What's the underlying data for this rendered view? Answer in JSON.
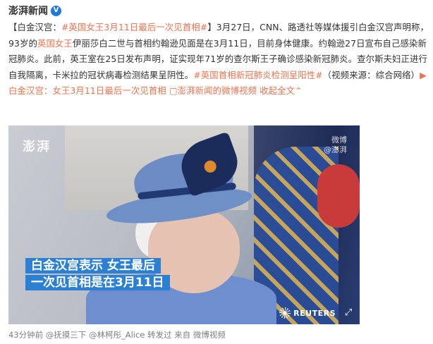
{
  "header": {
    "author": "澎湃新闻",
    "verified_mark": "V"
  },
  "post": {
    "prefix": "【白金汉宫：",
    "topic1": "#英国女王3月11日最后一次见首相#",
    "text1": "】3月27日，CNN、路透社等媒体援引白金汉宫声明称，93岁的",
    "topic_inline1": "英国女王",
    "text2": "伊丽莎白二世与首相约翰逊见面是在3月11日，目前身体健康。约翰逊27日宣布自己感染新冠肺炎。此前，英王室在25日发布声明，证实现年71岁的查尔斯王子确诊感染新冠肺炎。查尔斯夫妇正进行自我隔离，卡米拉的冠状病毒检测结果呈阴性。",
    "topic2": "#英国首相新冠肺炎检测呈阳性#",
    "text3": "（视频来源：综合网络）",
    "link_label": "白金汉宫：女王3月11日最后一次见首相",
    "link_icon": "video-link-icon",
    "link2": "澎湃新闻的微博视频",
    "expand": "收起全文",
    "expand_icon": "chevron-up-icon"
  },
  "video": {
    "watermark": "澎湃",
    "weibo_watermark": "微博",
    "weibo_sub": "@澎湃",
    "caption_line1": "白金汉宫表示 女王最后",
    "caption_line2": "一次见首相是在3月11日",
    "source": "REUTERS",
    "expand_icon": "fullscreen-icon"
  },
  "footer": {
    "time": "43分钟前",
    "user1": "@抚摸三下",
    "user2": "@林柯彤_Alice",
    "repost": "转发过",
    "from": "来自 微博视频"
  },
  "colors": {
    "link": "#eb7350",
    "text": "#333333",
    "meta": "#808080",
    "caption_bg": "#2d7fd1",
    "verified": "#1f78e0"
  }
}
